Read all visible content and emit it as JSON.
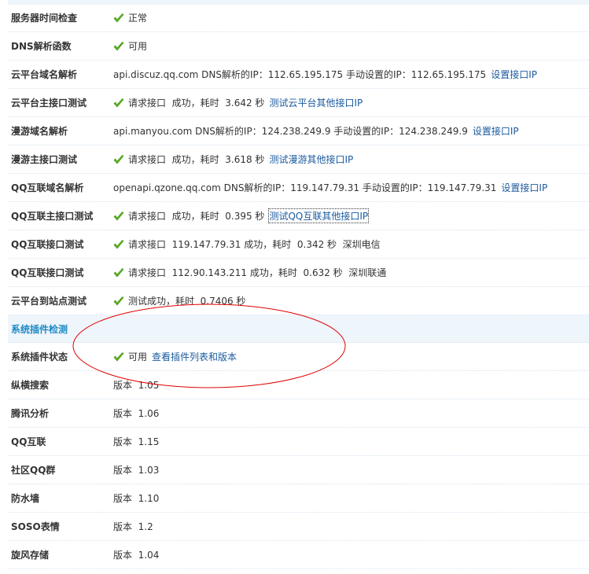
{
  "checks": [
    {
      "label": "服务器时间检查",
      "check": true,
      "text": "正常",
      "link": null
    },
    {
      "label": "DNS解析函数",
      "check": true,
      "text": "可用",
      "link": null
    },
    {
      "label": "云平台域名解析",
      "check": false,
      "text": "api.discuz.qq.com DNS解析的IP：112.65.195.175 手动设置的IP：112.65.195.175",
      "link": "设置接口IP"
    },
    {
      "label": "云平台主接口测试",
      "check": true,
      "text": "请求接口  成功，耗时  3.642 秒",
      "link": "测试云平台其他接口IP"
    },
    {
      "label": "漫游域名解析",
      "check": false,
      "text": "api.manyou.com DNS解析的IP：124.238.249.9 手动设置的IP：124.238.249.9",
      "link": "设置接口IP"
    },
    {
      "label": "漫游主接口测试",
      "check": true,
      "text": "请求接口  成功，耗时  3.618 秒",
      "link": "测试漫游其他接口IP"
    },
    {
      "label": "QQ互联域名解析",
      "check": false,
      "text": "openapi.qzone.qq.com DNS解析的IP：119.147.79.31 手动设置的IP：119.147.79.31",
      "link": "设置接口IP"
    },
    {
      "label": "QQ互联主接口测试",
      "check": true,
      "text": "请求接口  成功，耗时  0.395 秒",
      "link": "测试QQ互联其他接口IP"
    },
    {
      "label": "QQ互联接口测试",
      "check": true,
      "text": "请求接口  119.147.79.31 成功，耗时  0.342 秒  深圳电信",
      "link": null
    },
    {
      "label": "QQ互联接口测试",
      "check": true,
      "text": "请求接口  112.90.143.211 成功，耗时  0.632 秒  深圳联通",
      "link": null
    },
    {
      "label": "云平台到站点测试",
      "check": true,
      "text": "测试成功，耗时  0.7406 秒",
      "link": null
    }
  ],
  "section": {
    "title": "系统插件检测"
  },
  "plugins": [
    {
      "label": "系统插件状态",
      "check": true,
      "text": "可用",
      "link": "查看插件列表和版本"
    },
    {
      "label": "纵横搜索",
      "check": false,
      "text": "版本  1.05",
      "link": null
    },
    {
      "label": "腾讯分析",
      "check": false,
      "text": "版本  1.06",
      "link": null
    },
    {
      "label": "QQ互联",
      "check": false,
      "text": "版本  1.15",
      "link": null
    },
    {
      "label": "社区QQ群",
      "check": false,
      "text": "版本  1.03",
      "link": null
    },
    {
      "label": "防水墙",
      "check": false,
      "text": "版本  1.10",
      "link": null
    },
    {
      "label": "SOSO表情",
      "check": false,
      "text": "版本  1.2",
      "link": null
    },
    {
      "label": "旋风存储",
      "check": false,
      "text": "版本  1.04",
      "link": null
    }
  ],
  "colors": {
    "link": "#1a5a9e",
    "section": "#1d8ac4",
    "check": "#5fb61f",
    "annotation": "#e00000"
  }
}
